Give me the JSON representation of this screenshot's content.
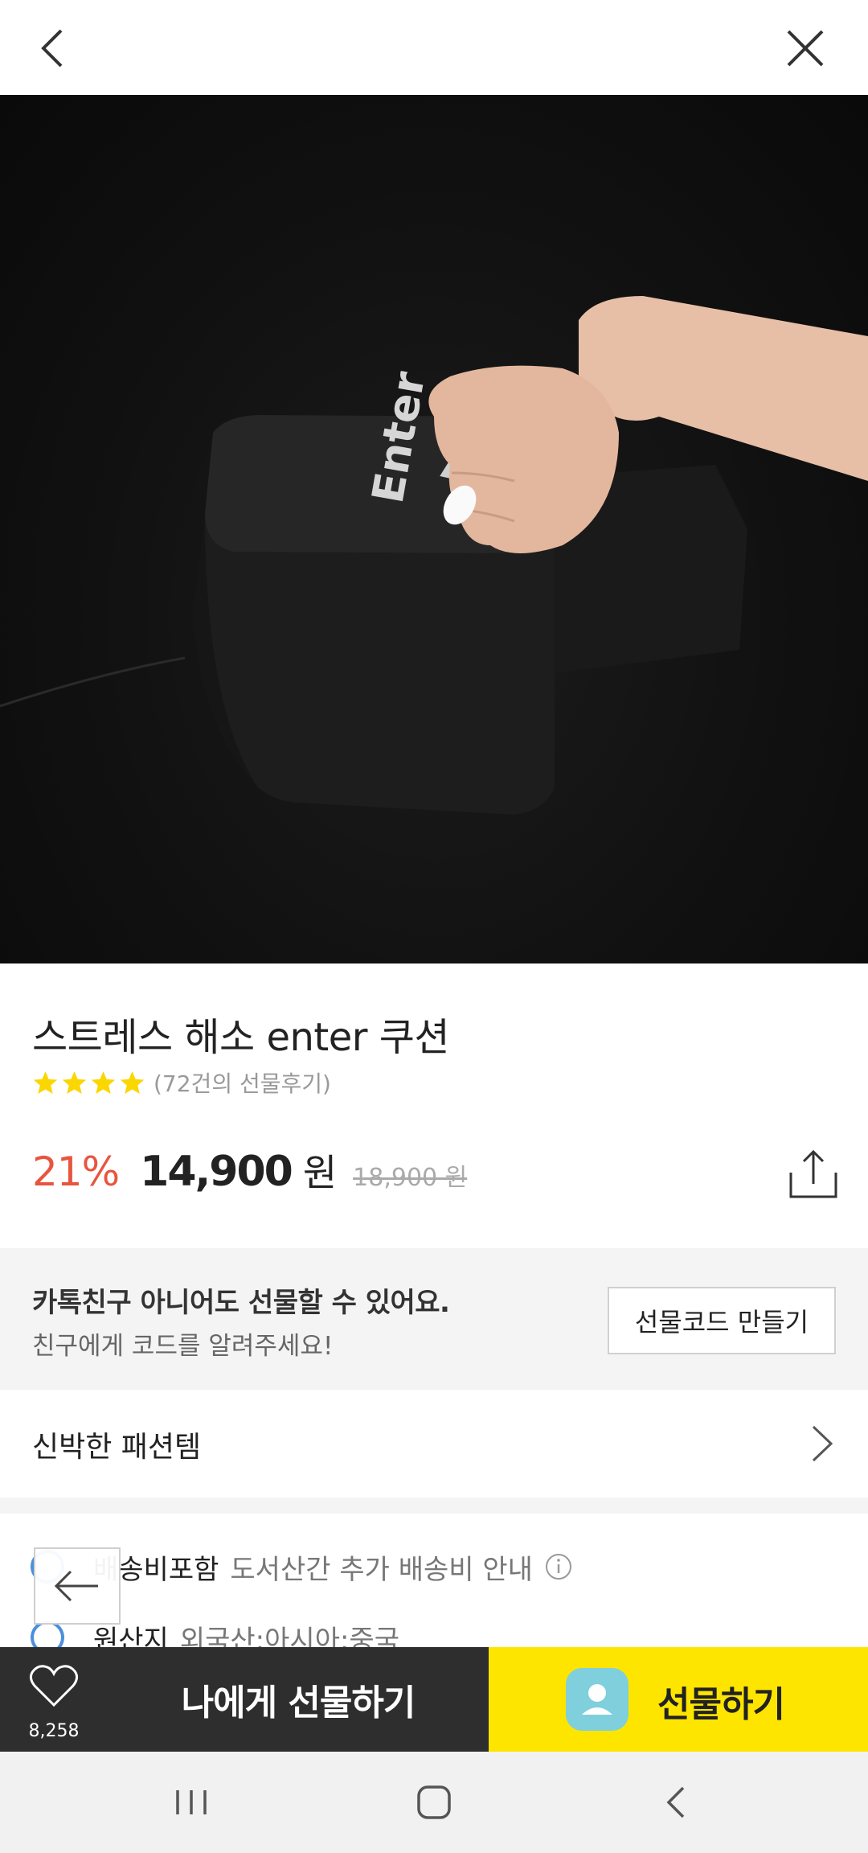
{
  "header": {
    "back_icon": "chevron-left-icon",
    "close_icon": "close-icon"
  },
  "hero": {
    "keycap_text": "Enter"
  },
  "product": {
    "title": "스트레스 해소 enter 쿠션",
    "rating_stars": 4,
    "review_count_text": "(72건의 선물후기)",
    "discount": "21%",
    "price": "14,900",
    "currency": "원",
    "original_price": "18,900 원",
    "share_icon": "share-icon"
  },
  "gift_code_banner": {
    "line1": "카톡친구 아니어도 선물할 수 있어요.",
    "line2": "친구에게 코드를 알려주세요!",
    "button_label": "선물코드 만들기"
  },
  "category": {
    "label": "신박한 패션템",
    "icon": "chevron-right-icon"
  },
  "shipping": {
    "bold_text": "배송비포함",
    "detail_text": "도서산간 추가 배송비 안내",
    "info_icon": "info-icon"
  },
  "origin": {
    "bold_text": "원산지",
    "detail_text": "외국산:아시아:중국"
  },
  "bottom_bar": {
    "wish_count": "8,258",
    "self_gift_label": "나에게 선물하기",
    "gift_label": "선물하기",
    "colors": {
      "dark": "#2e2e2e",
      "accent": "#fee500",
      "discount": "#e8553e"
    }
  },
  "system_nav": {
    "recent_icon": "recent-apps-icon",
    "home_icon": "home-icon",
    "back_icon": "back-icon"
  }
}
